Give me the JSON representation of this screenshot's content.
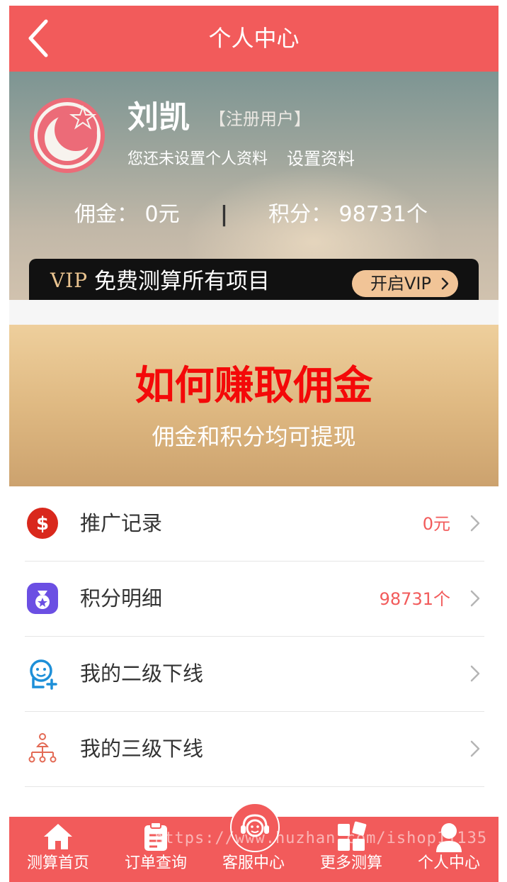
{
  "header": {
    "title": "个人中心"
  },
  "profile": {
    "name": "刘凯",
    "user_tag": "【注册用户】",
    "hint": "您还未设置个人资料",
    "setup_link": "设置资料",
    "commission": "佣金： 0元",
    "separator": "|",
    "points": "积分： 98731个"
  },
  "vip": {
    "logo": "VIP",
    "text": "免费测算所有项目",
    "button": "开启VIP"
  },
  "banner": {
    "title": "如何赚取佣金",
    "subtitle": "佣金和积分均可提现"
  },
  "list": [
    {
      "label": "推广记录",
      "value": "0元",
      "icon": "dollar-icon"
    },
    {
      "label": "积分明细",
      "value": "98731个",
      "icon": "money-bag-icon"
    },
    {
      "label": "我的二级下线",
      "value": "",
      "icon": "add-user-icon"
    },
    {
      "label": "我的三级下线",
      "value": "",
      "icon": "org-chart-icon"
    }
  ],
  "nav": [
    {
      "label": "测算首页",
      "icon": "home-icon"
    },
    {
      "label": "订单查询",
      "icon": "clipboard-icon"
    },
    {
      "label": "客服中心",
      "icon": "headset-icon"
    },
    {
      "label": "更多测算",
      "icon": "grid-icon"
    },
    {
      "label": "个人中心",
      "icon": "user-icon"
    }
  ],
  "watermark": "https://www.huzhan.com/ishop11135",
  "colors": {
    "accent": "#f25b5b",
    "banner_title": "#f40909",
    "vip_gold": "#f1c497"
  }
}
